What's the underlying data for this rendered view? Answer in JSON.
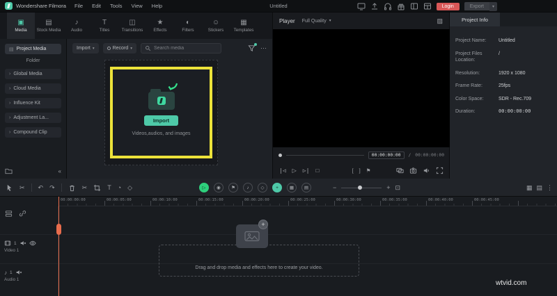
{
  "app": {
    "name": "Wondershare Filmora",
    "menus": [
      "File",
      "Edit",
      "Tools",
      "View",
      "Help"
    ],
    "document_title": "Untitled",
    "login_label": "Login",
    "export_label": "Export"
  },
  "media_tabs": [
    {
      "label": "Media",
      "icon": "▣"
    },
    {
      "label": "Stock Media",
      "icon": "▤"
    },
    {
      "label": "Audio",
      "icon": "♪"
    },
    {
      "label": "Titles",
      "icon": "T"
    },
    {
      "label": "Transitions",
      "icon": "◫"
    },
    {
      "label": "Effects",
      "icon": "★"
    },
    {
      "label": "Filters",
      "icon": "◐"
    },
    {
      "label": "Stickers",
      "icon": "☺"
    },
    {
      "label": "Templates",
      "icon": "▦"
    }
  ],
  "sidebar": {
    "project_media": "Project Media",
    "folder_header": "Folder",
    "items": [
      "Global Media",
      "Cloud Media",
      "Influence Kit",
      "Adjustment La...",
      "Compound Clip"
    ]
  },
  "media_toolbar": {
    "import": "Import",
    "record": "Record",
    "search_placeholder": "Search media"
  },
  "import_zone": {
    "button": "Import",
    "caption": "Videos,audios, and images"
  },
  "player": {
    "title": "Player",
    "quality": "Full Quality",
    "current": "00:00:00:00",
    "separator": "/",
    "total": "00:00:00:00"
  },
  "project_info": {
    "tab": "Project Info",
    "fields": [
      {
        "label": "Project Name:",
        "value": "Untitled"
      },
      {
        "label": "Project Files Location:",
        "value": "/"
      },
      {
        "label": "Resolution:",
        "value": "1920 x 1080"
      },
      {
        "label": "Frame Rate:",
        "value": "25fps"
      },
      {
        "label": "Color Space:",
        "value": "SDR - Rec.709"
      },
      {
        "label": "Duration:",
        "value": "00:00:00:00"
      }
    ]
  },
  "timeline": {
    "ruler": [
      "00:00:00:00",
      "00:00:05:00",
      "00:00:10:00",
      "00:00:15:00",
      "00:00:20:00",
      "00:00:25:00",
      "00:00:30:00",
      "00:00:35:00",
      "00:00:40:00",
      "00:00:45:00"
    ],
    "tracks": [
      {
        "name": "Video 1",
        "badge": "1"
      },
      {
        "name": "Audio 1",
        "badge": "1"
      }
    ],
    "drop_message": "Drag and drop media and effects here to create your video."
  },
  "watermark": "wtvid.com",
  "colors": {
    "accent": "#4ec9a8",
    "login_red": "#d95757",
    "highlight_yellow": "#ece23a",
    "playhead_orange": "#e86c4c"
  },
  "icons": {
    "chevron_down": "▾",
    "ellipsis": "⋯",
    "more_dots": "⋮",
    "undo": "↶",
    "redo": "↷",
    "scissors": "✂",
    "text_tool": "T",
    "speed": "◔",
    "keyframe": "◇",
    "prev_frame": "|◁",
    "play": "▷",
    "next_frame": "▷|",
    "stop": "□",
    "mark_in": "[",
    "mark_out": "]",
    "flag": "⚑",
    "collapse": "«",
    "chevron_right": "›",
    "plus": "+",
    "minus": "−",
    "music_note": "♪",
    "marker": "◉",
    "grid": "▦",
    "panel": "▤",
    "fit": "⊡",
    "preview_media": "▨"
  }
}
